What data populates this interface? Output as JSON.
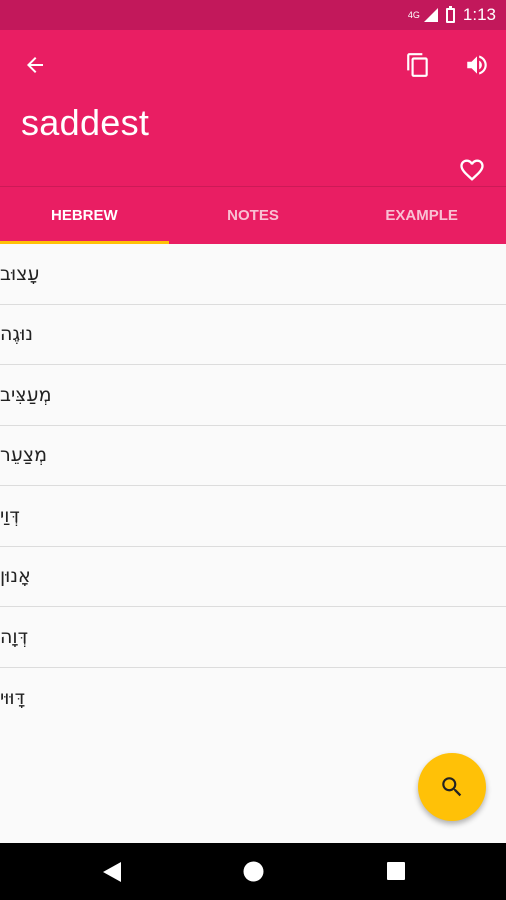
{
  "status_bar": {
    "network": "4G",
    "time": "1:13"
  },
  "app_bar": {
    "word": "saddest"
  },
  "icons": {
    "back": "arrow-back-icon",
    "copy": "copy-icon",
    "speaker": "volume-up-icon",
    "favorite": "heart-outline-icon",
    "search": "search-icon"
  },
  "tabs": [
    {
      "label": "HEBREW",
      "active": true
    },
    {
      "label": "NOTES",
      "active": false
    },
    {
      "label": "EXAMPLE",
      "active": false
    }
  ],
  "translations": [
    "עָצוּב",
    "נוּגֶה",
    "מְעַצִּיב",
    "מְצַעֵר",
    "דְּוַי",
    "אָנוּן",
    "דְּוָה",
    "דָּוּוּי"
  ],
  "colors": {
    "primary": "#e91e63",
    "status_bar": "#c2185b",
    "accent": "#ffc107"
  }
}
